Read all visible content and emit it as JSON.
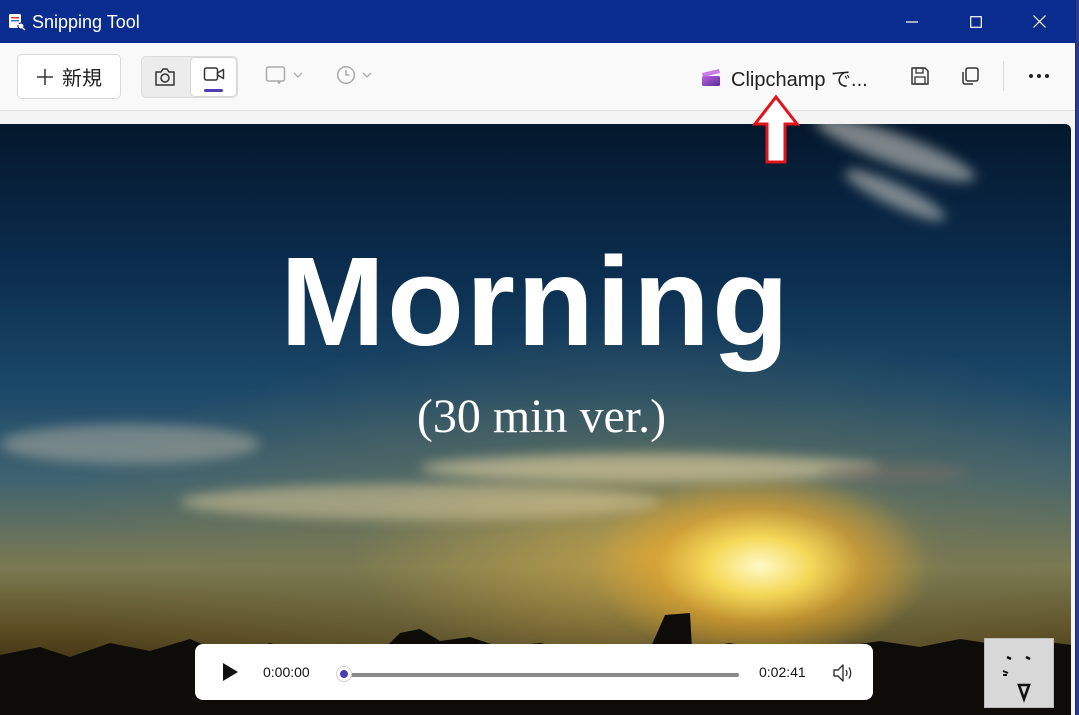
{
  "titlebar": {
    "title": "Snipping Tool",
    "app_icon": "snipping-tool-icon",
    "controls": [
      "minimize-icon",
      "maximize-icon",
      "close-icon"
    ]
  },
  "toolbar": {
    "new_label": "新規",
    "new_icon": "plus-icon",
    "modes": [
      {
        "name": "screenshot",
        "icon": "camera-icon",
        "selected": false
      },
      {
        "name": "record",
        "icon": "video-camera-icon",
        "selected": true
      }
    ],
    "shape_dropdown_icon": "rectangle-snip-icon",
    "delay_dropdown_icon": "clock-icon",
    "clipchamp_label": "Clipchamp で...",
    "clipchamp_icon": "clipchamp-icon",
    "save_icon": "save-icon",
    "copy_icon": "copy-icon",
    "more_icon": "more-icon"
  },
  "colors": {
    "titlebar": "#0a2c8f",
    "accent": "#4b3fb3",
    "annotation_arrow": "#e0141b"
  },
  "video": {
    "title": "Morning",
    "subtitle": "(30 min ver.)"
  },
  "player": {
    "play_icon": "play-icon",
    "current_time": "0:00:00",
    "duration": "0:02:41",
    "progress": 0,
    "volume_icon": "volume-icon"
  }
}
